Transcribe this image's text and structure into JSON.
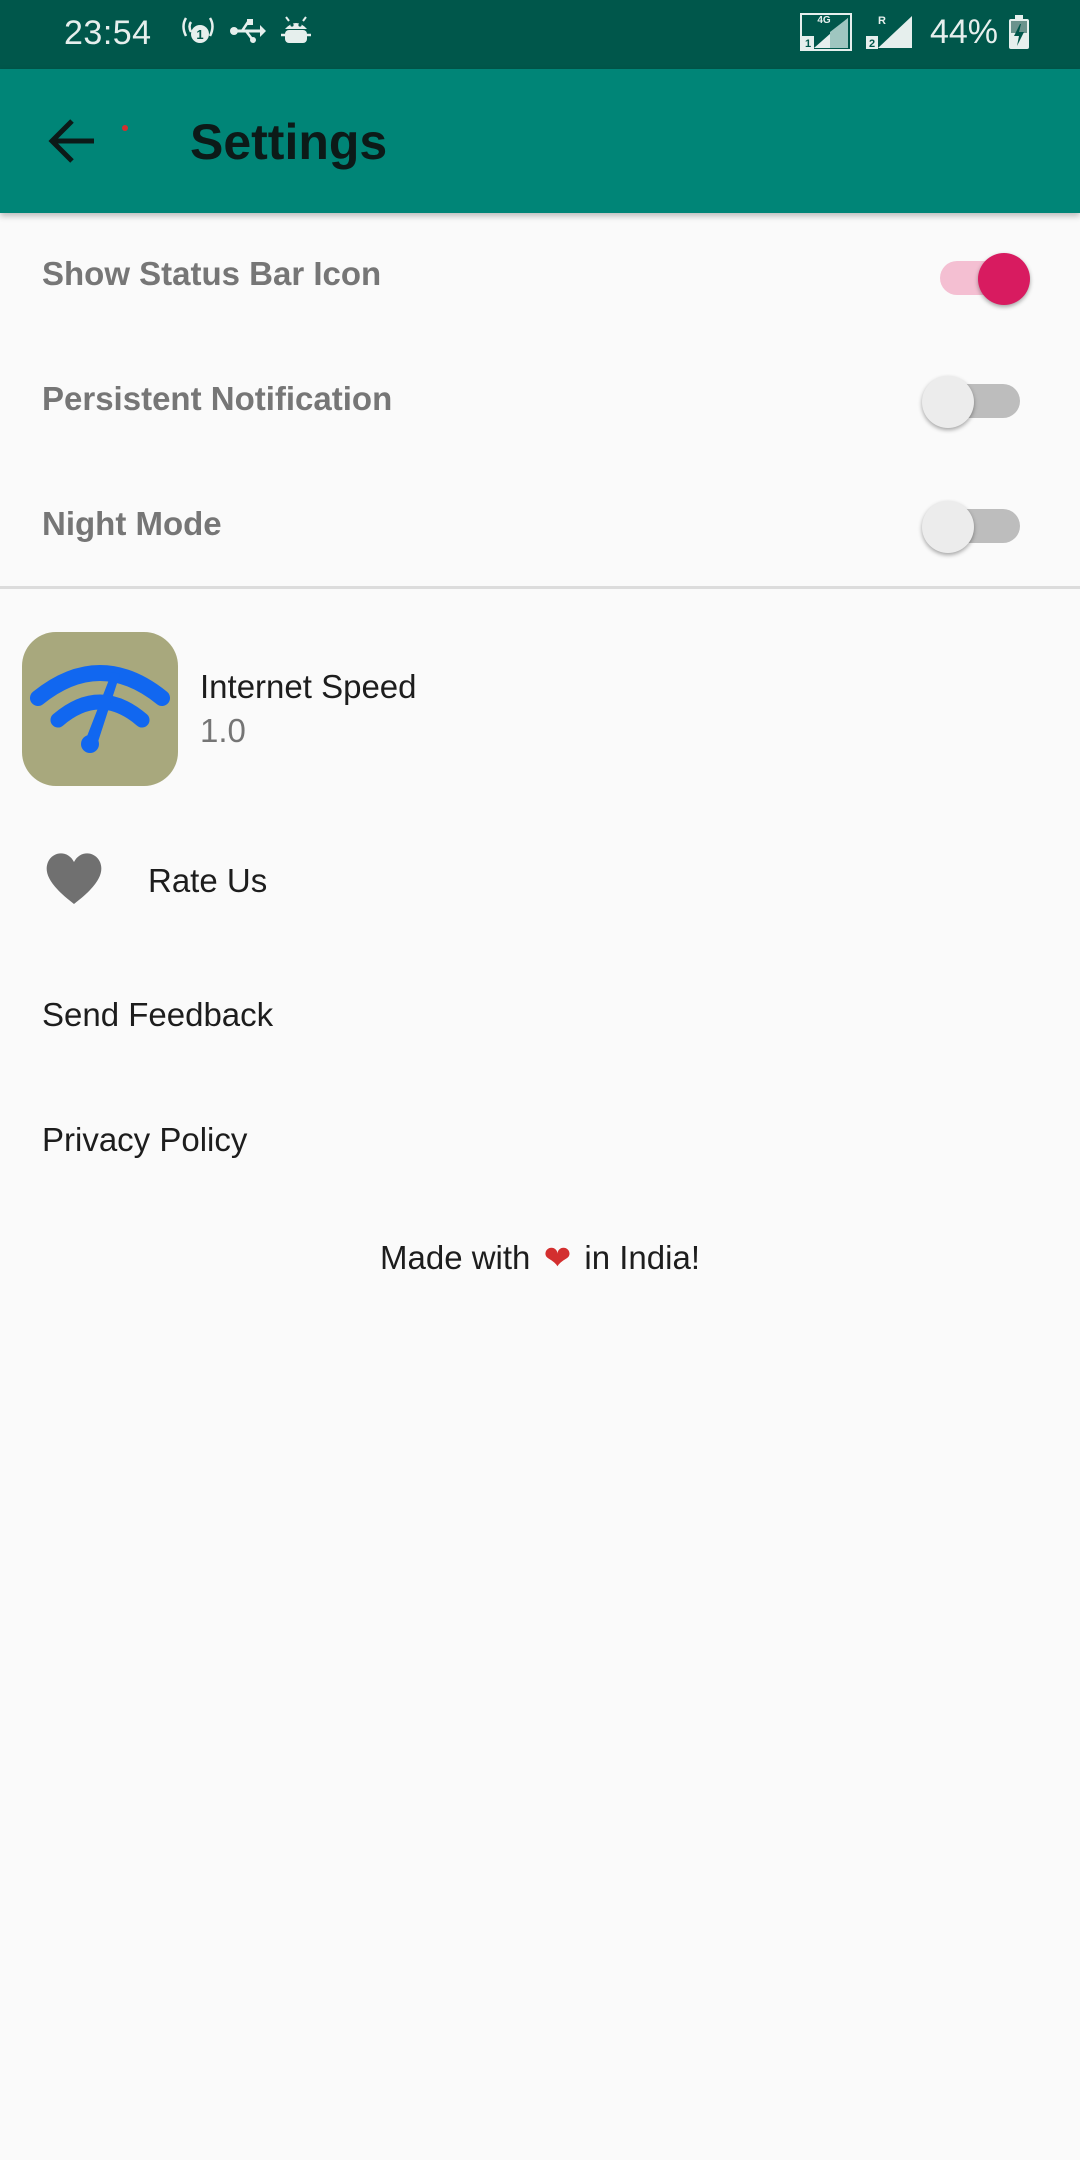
{
  "status_bar": {
    "time": "23:54",
    "battery": "44%",
    "sim1_network": "4G",
    "sim1_slot": "1",
    "sim2_roaming": "R",
    "sim2_slot": "2"
  },
  "app_bar": {
    "title": "Settings"
  },
  "settings": [
    {
      "label": "Show Status Bar Icon",
      "enabled": true
    },
    {
      "label": "Persistent Notification",
      "enabled": false
    },
    {
      "label": "Night Mode",
      "enabled": false
    }
  ],
  "app_info": {
    "name": "Internet Speed",
    "version": "1.0"
  },
  "rate": {
    "label": "Rate Us"
  },
  "links": {
    "send_feedback": "Send Feedback",
    "privacy_policy": "Privacy Policy"
  },
  "footer": {
    "prefix": "Made with",
    "heart": "❤",
    "suffix": "in India!"
  },
  "colors": {
    "status_bar": "#00574b",
    "app_bar": "#008577",
    "accent": "#d81b60",
    "accent_track": "#f4bfd2",
    "switch_off_thumb": "#ececec",
    "switch_off_track": "#bdbdbd",
    "app_logo_bg": "#a8a87d",
    "app_logo_fg": "#1167f0",
    "background": "#fafafa"
  },
  "icons": {
    "back": "arrow-back-icon",
    "hotspot": "hotspot-icon",
    "usb": "usb-icon",
    "android": "android-debug-icon",
    "signal": "signal-icon",
    "battery": "battery-charging-icon",
    "rate": "heart-icon",
    "logo": "speedometer-wifi-icon"
  }
}
